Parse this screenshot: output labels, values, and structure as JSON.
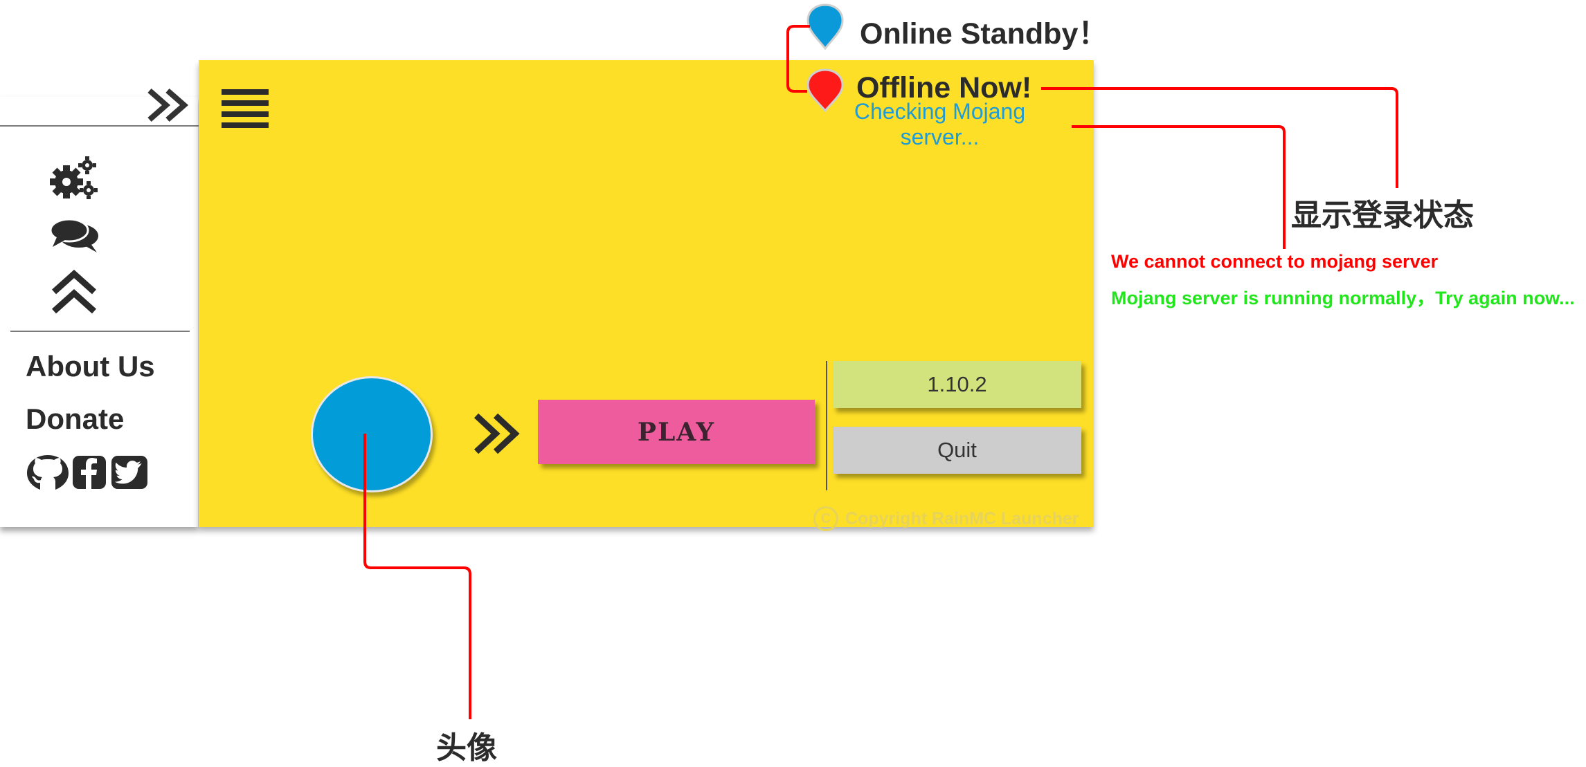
{
  "sidebar": {
    "collapse_icon": "double-chevron-right-icon",
    "icons": [
      "gears-icon",
      "chat-bubbles-icon",
      "double-chevron-up-icon"
    ],
    "about": "About Us",
    "donate": "Donate",
    "social_icons": [
      "github-icon",
      "facebook-icon",
      "twitter-icon"
    ]
  },
  "header": {
    "menu_icon": "hamburger-menu-icon"
  },
  "status": {
    "online": "Online Standby！",
    "offline": "Offline Now!",
    "checking": "Checking Mojang server..."
  },
  "actions": {
    "play": "PLAY",
    "version": "1.10.2",
    "quit": "Quit",
    "arrow_icon": "double-chevron-right-icon"
  },
  "footer": {
    "copyright": "Copyright RainMC  Launcher"
  },
  "annotations": {
    "login_status": "显示登录状态",
    "cannot_connect": "We cannot connect to mojang server",
    "running_normally": "Mojang server is running normally，Try again now...",
    "avatar": "头像"
  },
  "colors": {
    "panel": "#fddf27",
    "play": "#ee5c9d",
    "version": "#d2e37e",
    "quit": "#cdcdcd",
    "avatar": "#029cd9",
    "online_pin": "#0a9ad9",
    "offline_pin": "#ff1a1a",
    "annotation_line": "#ff0000",
    "ok_text": "#21e61c"
  }
}
